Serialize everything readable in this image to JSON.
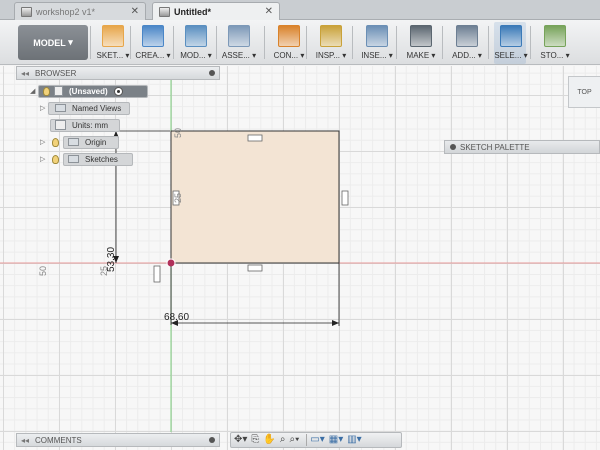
{
  "tabs": [
    {
      "label": "workshop2 v1*",
      "active": false
    },
    {
      "label": "Untitled*",
      "active": true
    }
  ],
  "toolbar": {
    "workspace": "MODEL",
    "tools": [
      {
        "label": "SKET...",
        "icon": "sketch-icon",
        "color": "#e7a64a"
      },
      {
        "label": "CREA...",
        "icon": "create-box-icon",
        "color": "#4a86c7"
      },
      {
        "label": "MOD...",
        "icon": "modify-icon",
        "color": "#5a8fc0"
      },
      {
        "label": "ASSE...",
        "icon": "assemble-icon",
        "color": "#7d99b8"
      },
      {
        "label": "CON...",
        "icon": "construct-icon",
        "color": "#d9822b"
      },
      {
        "label": "INSP...",
        "icon": "inspect-measure-icon",
        "color": "#c9a23a"
      },
      {
        "label": "INSE...",
        "icon": "insert-image-icon",
        "color": "#6b8fb5"
      },
      {
        "label": "MAKE",
        "icon": "make-3dprint-icon",
        "color": "#5b6670"
      },
      {
        "label": "ADD...",
        "icon": "addins-icon",
        "color": "#6d7f93"
      },
      {
        "label": "SELE...",
        "icon": "select-cursor-icon",
        "color": "#3b7ab8"
      },
      {
        "label": "STO...",
        "icon": "stop-sketch-icon",
        "color": "#77a35a"
      }
    ]
  },
  "browser": {
    "title": "BROWSER",
    "root": "(Unsaved)",
    "items": [
      {
        "label": "Named Views"
      },
      {
        "label": "Units: mm"
      },
      {
        "label": "Origin"
      },
      {
        "label": "Sketches"
      }
    ]
  },
  "viewcube": {
    "face": "TOP"
  },
  "sketch_palette": {
    "title": "SKETCH PALETTE"
  },
  "comments": {
    "title": "COMMENTS"
  },
  "dimensions": {
    "width": "68.60",
    "height": "53.30",
    "grid_top": "50",
    "grid_left": "50",
    "grid_mid": "25",
    "grid_small": "25"
  },
  "colors": {
    "sketch_fill": "#f3e4d4",
    "x_axis": "#e89a9a",
    "y_axis": "#7fd17f"
  }
}
